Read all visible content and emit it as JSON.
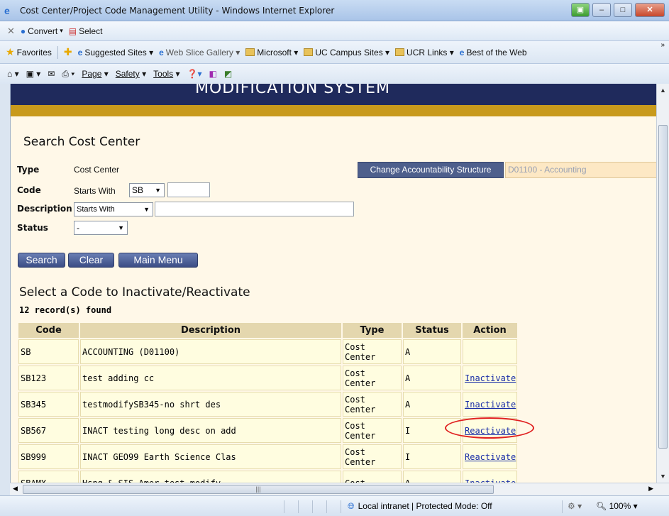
{
  "window": {
    "title": "Cost Center/Project Code Management Utility - Windows Internet Explorer"
  },
  "command_bar": {
    "convert_label": "Convert",
    "select_label": "Select"
  },
  "favorites_bar": {
    "favorites_label": "Favorites",
    "links": [
      "Suggested Sites ▾",
      "Web Slice Gallery ▾",
      "Microsoft ▾",
      "UC Campus Sites ▾",
      "UCR Links ▾",
      "Best of the Web"
    ],
    "overflow": "»"
  },
  "tools_bar": {
    "page_label": "Page",
    "safety_label": "Safety",
    "tools_label": "Tools"
  },
  "page": {
    "banner_text": "MODIFICATION SYSTEM",
    "search_title": "Search Cost Center",
    "type_label": "Type",
    "type_value": "Cost Center",
    "code_label": "Code",
    "code_match": "Starts With",
    "code_select_value": "SB",
    "description_label": "Description",
    "description_select_value": "Starts With",
    "status_label": "Status",
    "status_select_value": "-",
    "change_structure_button": "Change Accountability Structure",
    "structure_value": "D01100 - Accounting",
    "buttons": {
      "search": "Search",
      "clear": "Clear",
      "main_menu": "Main Menu"
    },
    "select_title": "Select a Code to Inactivate/Reactivate",
    "records_found": "12 record(s) found"
  },
  "table": {
    "headers": [
      "Code",
      "Description",
      "Type",
      "Status",
      "Action"
    ],
    "rows": [
      {
        "code": "SB",
        "description": "ACCOUNTING (D01100)",
        "type": "Cost Center",
        "status": "A",
        "action": ""
      },
      {
        "code": "SB123",
        "description": "test adding cc",
        "type": "Cost Center",
        "status": "A",
        "action": "Inactivate"
      },
      {
        "code": "SB345",
        "description": "testmodifySB345-no shrt des",
        "type": "Cost Center",
        "status": "A",
        "action": "Inactivate"
      },
      {
        "code": "SB567",
        "description": "INACT testing long desc on add",
        "type": "Cost Center",
        "status": "I",
        "action": "Reactivate"
      },
      {
        "code": "SB999",
        "description": "INACT GEO99 Earth Science Clas",
        "type": "Cost Center",
        "status": "I",
        "action": "Reactivate"
      },
      {
        "code": "SBAMX",
        "description": "Hsng & SIS Amer test modify",
        "type": "Cost",
        "status": "A",
        "action": "Inactivate"
      }
    ]
  },
  "status_bar": {
    "zone_text": "Local intranet | Protected Mode: Off",
    "zoom_text": "100%"
  }
}
